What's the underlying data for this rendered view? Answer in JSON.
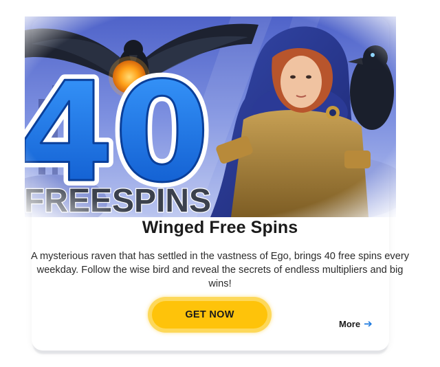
{
  "promo": {
    "banner": {
      "number": "40",
      "subtitle": "FREESPINS"
    },
    "title": "Winged Free Spins",
    "description": "A mysterious raven that has settled in the vastness of Ego, brings 40 free spins every weekday. Follow the wise bird and reveal the secrets of endless multipliers and big wins!",
    "cta_label": "GET NOW",
    "more_label": "More",
    "more_icon": "arrow-right-icon"
  },
  "colors": {
    "cta": "#fec30a",
    "link_arrow": "#1f7be0",
    "number_blue": "#1f7be0"
  }
}
